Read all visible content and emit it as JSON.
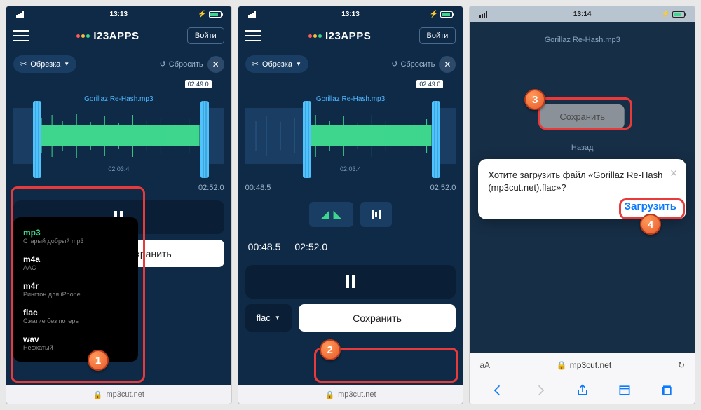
{
  "status": {
    "time1": "13:13",
    "time2": "13:13",
    "time3": "13:14"
  },
  "app": {
    "name": "I23APPS",
    "signin": "Войти"
  },
  "toolbar": {
    "trim": "Обрезка",
    "reset": "Сбросить"
  },
  "audio": {
    "filename": "Gorillaz Re-Hash.mp3",
    "end_marker": "02:49.0",
    "mid_marker": "02:03.4",
    "total": "02:52.0",
    "start_p2": "00:48.5"
  },
  "times": {
    "start": "00:48.5",
    "end": "02:52.0"
  },
  "format_menu": [
    {
      "name": "mp3",
      "desc": "Старый добрый mp3",
      "selected": true
    },
    {
      "name": "m4a",
      "desc": "AAC"
    },
    {
      "name": "m4r",
      "desc": "Рингтон для iPhone"
    },
    {
      "name": "flac",
      "desc": "Сжатие без потерь"
    },
    {
      "name": "wav",
      "desc": "Несжатый"
    }
  ],
  "bottom": {
    "fmt1": "mp3",
    "fmt2": "flac",
    "save": "Сохранить"
  },
  "safari": {
    "domain": "mp3cut.net",
    "aa": "aA"
  },
  "panel3": {
    "filename": "Gorillaz Re-Hash.mp3",
    "save": "Сохранить",
    "back": "Назад",
    "dialog_text": "Хотите загрузить файл «Gorillaz Re-Hash (mp3cut.net).flac»?",
    "download": "Загрузить"
  },
  "callouts": {
    "c1": "1",
    "c2": "2",
    "c3": "3",
    "c4": "4"
  }
}
